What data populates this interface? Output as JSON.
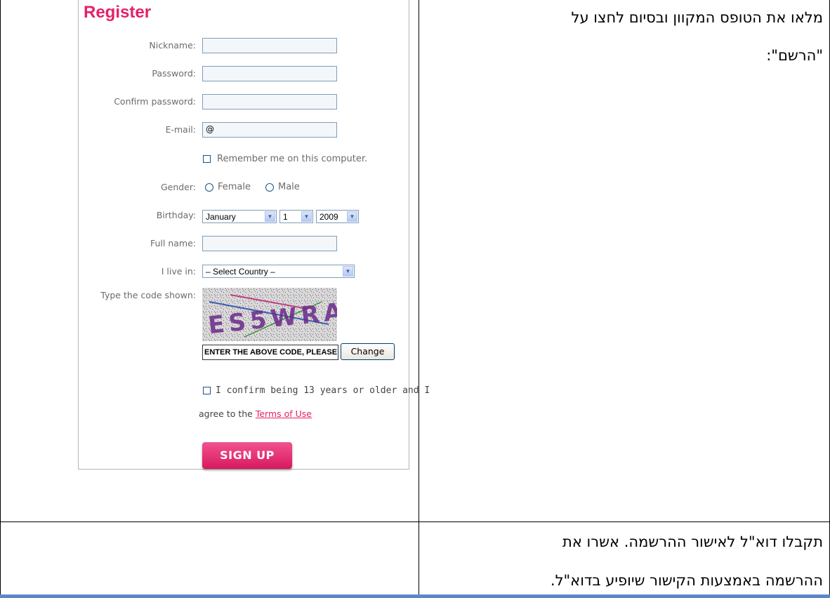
{
  "instructions": {
    "step1_line1": "מלאו את הטופס המקוון ובסיום לחצו על",
    "step1_line2": "\"הרשם\":",
    "step2_line1": "תקבלו דוא\"ל לאישור ההרשמה. אשרו את",
    "step2_line2": "ההרשמה באמצעות הקישור שיופיע בדוא\"ל."
  },
  "form": {
    "title": "Register",
    "nickname_label": "Nickname:",
    "nickname_value": "",
    "password_label": "Password:",
    "password_value": "",
    "confirm_label": "Confirm password:",
    "confirm_value": "",
    "email_label": "E-mail:",
    "email_value": "@",
    "remember_label": "Remember me on this computer.",
    "remember_checked": false,
    "gender_label": "Gender:",
    "gender_female": "Female",
    "gender_male": "Male",
    "birthday_label": "Birthday:",
    "birthday_month": "January",
    "birthday_day": "1",
    "birthday_year": "2009",
    "fullname_label": "Full name:",
    "fullname_value": "",
    "country_label": "I live in:",
    "country_value": "– Select Country –",
    "code_label": "Type the code shown:",
    "captcha_text": "ES5WRA",
    "code_input_value": "ENTER THE ABOVE CODE, PLEASE",
    "change_button": "Change",
    "confirm_age_line1": "I confirm being 13 years or older and I",
    "confirm_age_prefix": "agree to the",
    "terms_link": "Terms of Use",
    "signup_button": "SIGN UP"
  },
  "icons": {
    "dropdown": "chevron-down-icon",
    "checkbox": "checkbox-icon",
    "radio": "radio-icon"
  },
  "colors": {
    "brand_pink": "#e6206a",
    "input_border": "#7f9db9",
    "footer_bar": "#5b87c9"
  }
}
